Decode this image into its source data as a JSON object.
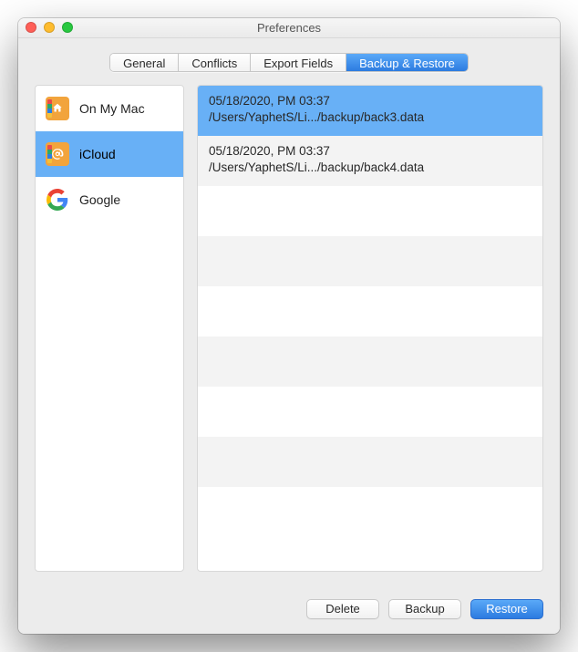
{
  "window": {
    "title": "Preferences"
  },
  "tabs": [
    {
      "label": "General",
      "active": false
    },
    {
      "label": "Conflicts",
      "active": false
    },
    {
      "label": "Export Fields",
      "active": false
    },
    {
      "label": "Backup & Restore",
      "active": true
    }
  ],
  "accounts": [
    {
      "label": "On My Mac",
      "icon": "home",
      "selected": false
    },
    {
      "label": "iCloud",
      "icon": "at",
      "selected": true
    },
    {
      "label": "Google",
      "icon": "google",
      "selected": false
    }
  ],
  "backups": [
    {
      "date": "05/18/2020, PM 03:37",
      "path": "/Users/YaphetS/Li.../backup/back3.data",
      "selected": true
    },
    {
      "date": "05/18/2020, PM 03:37",
      "path": "/Users/YaphetS/Li.../backup/back4.data",
      "selected": false
    }
  ],
  "buttons": {
    "delete": "Delete",
    "backup": "Backup",
    "restore": "Restore"
  },
  "colors": {
    "selection": "#68b0f6",
    "accent": "#2c7be0"
  }
}
